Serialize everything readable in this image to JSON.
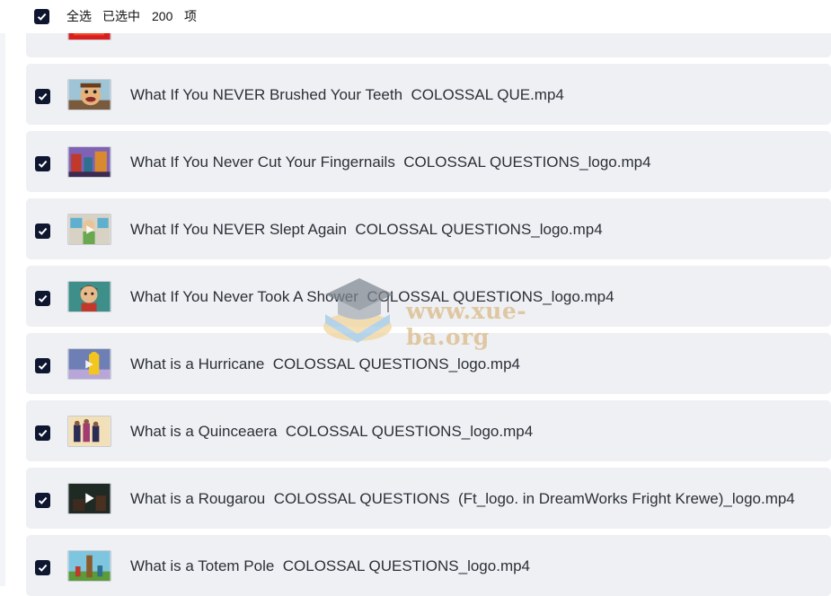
{
  "header": {
    "select_all_label": "全选",
    "selected_label": "已选中",
    "selected_count": "200",
    "unit_label": "项"
  },
  "files": [
    {
      "name": "",
      "checked": true,
      "thumb": "red"
    },
    {
      "name": "What If You NEVER Brushed Your Teeth  COLOSSAL QUE.mp4",
      "checked": true,
      "thumb": "face"
    },
    {
      "name": "What If You Never Cut Your Fingernails  COLOSSAL QUESTIONS_logo.mp4",
      "checked": true,
      "thumb": "city"
    },
    {
      "name": "What If You NEVER Slept Again  COLOSSAL QUESTIONS_logo.mp4",
      "checked": true,
      "thumb": "room"
    },
    {
      "name": "What If You Never Took A Shower  COLOSSAL QUESTIONS_logo.mp4",
      "checked": true,
      "thumb": "boy"
    },
    {
      "name": "What is a Hurricane  COLOSSAL QUESTIONS_logo.mp4",
      "checked": true,
      "thumb": "storm"
    },
    {
      "name": "What is a Quinceaera  COLOSSAL QUESTIONS_logo.mp4",
      "checked": true,
      "thumb": "party"
    },
    {
      "name": "What is a Rougarou  COLOSSAL QUESTIONS  (Ft_logo. in DreamWorks Fright Krewe)_logo.mp4",
      "checked": true,
      "thumb": "dark"
    },
    {
      "name": "What is a Totem Pole  COLOSSAL QUESTIONS_logo.mp4",
      "checked": true,
      "thumb": "totem"
    }
  ],
  "watermark": {
    "text": "www.xue-ba.org"
  },
  "colors": {
    "checkbox": "#0f1630",
    "row_bg": "#eff0f3",
    "text": "#2b2f38"
  }
}
